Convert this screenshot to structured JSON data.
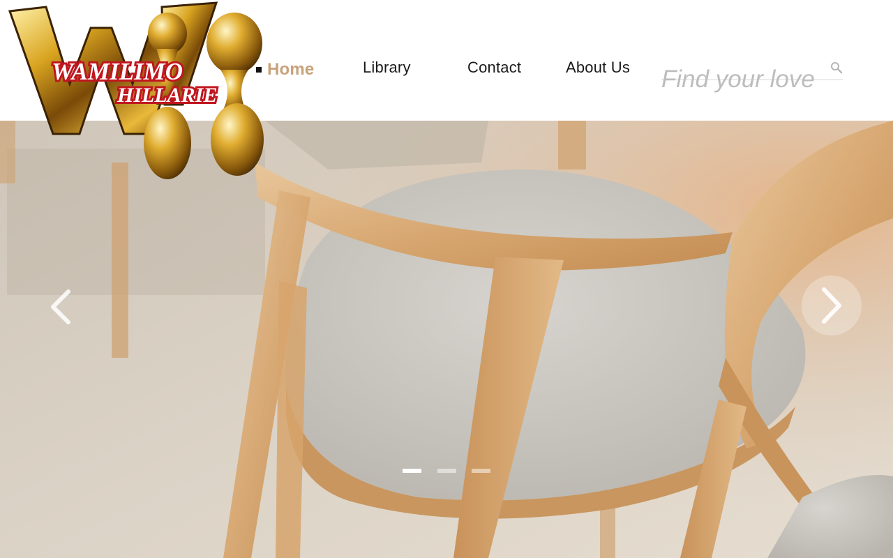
{
  "brand": {
    "logo_line1": "WAMILIMO",
    "logo_line2": "HILLARIE",
    "logo_monogram": "W"
  },
  "nav": {
    "items": [
      {
        "label": "Home",
        "active": true
      },
      {
        "label": "Library",
        "active": false
      },
      {
        "label": "Contact",
        "active": false
      },
      {
        "label": "About Us",
        "active": false
      }
    ]
  },
  "search": {
    "placeholder": "Find your love",
    "icon": "search-icon"
  },
  "slider": {
    "prev_icon": "chevron-left-icon",
    "next_icon": "chevron-right-icon",
    "slide_count": 3,
    "active_slide": 1,
    "image_subject": "wooden-chairs-photo"
  },
  "colors": {
    "accent": "#c9a27a",
    "nav_text": "#1a1a1a",
    "placeholder": "#bdbdbd",
    "logo_red": "#d6202a",
    "logo_gold": "#d4a11e"
  }
}
